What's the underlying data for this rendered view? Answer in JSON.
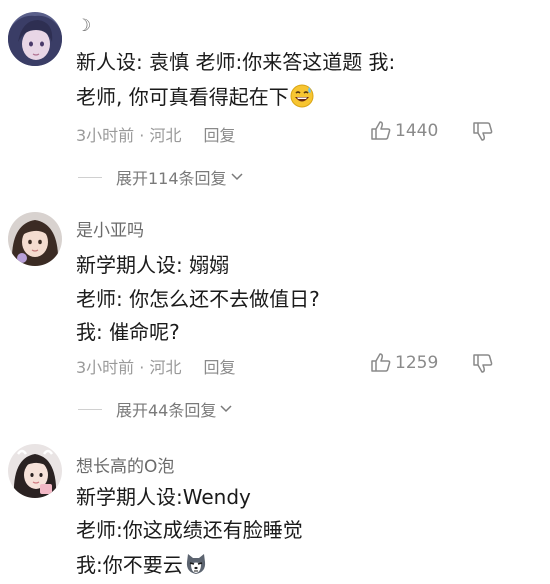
{
  "comments": [
    {
      "username": "☽",
      "lines": [
        "新人设:  袁慎   老师:你来答这道题   我:",
        "老师,  你可真看得起在下"
      ],
      "time": "3小时前 · 河北",
      "reply": "回复",
      "likes": "1440",
      "expand": "展开114条回复",
      "emoji": "grinning-sweat-emoji"
    },
    {
      "username": "是小亚吗",
      "lines": [
        "新学期人设:  嫋嫋",
        "老师:  你怎么还不去做值日?",
        "我:  催命呢?"
      ],
      "time": "3小时前 · 河北",
      "reply": "回复",
      "likes": "1259",
      "expand": "展开44条回复"
    },
    {
      "username": "想长高的O泡",
      "lines": [
        "新学期人设:Wendy",
        "老师:你这成绩还有脸睡觉",
        "我:你不要云"
      ],
      "emoji": "husky-emoji"
    }
  ],
  "icons": {
    "like": "thumbs-up-icon",
    "dislike": "thumbs-down-icon",
    "expand_arrow": "chevron-down-icon"
  },
  "colors": {
    "text": "#1a1a1a",
    "username": "#6b6b6b",
    "meta": "#9a9a9a"
  }
}
